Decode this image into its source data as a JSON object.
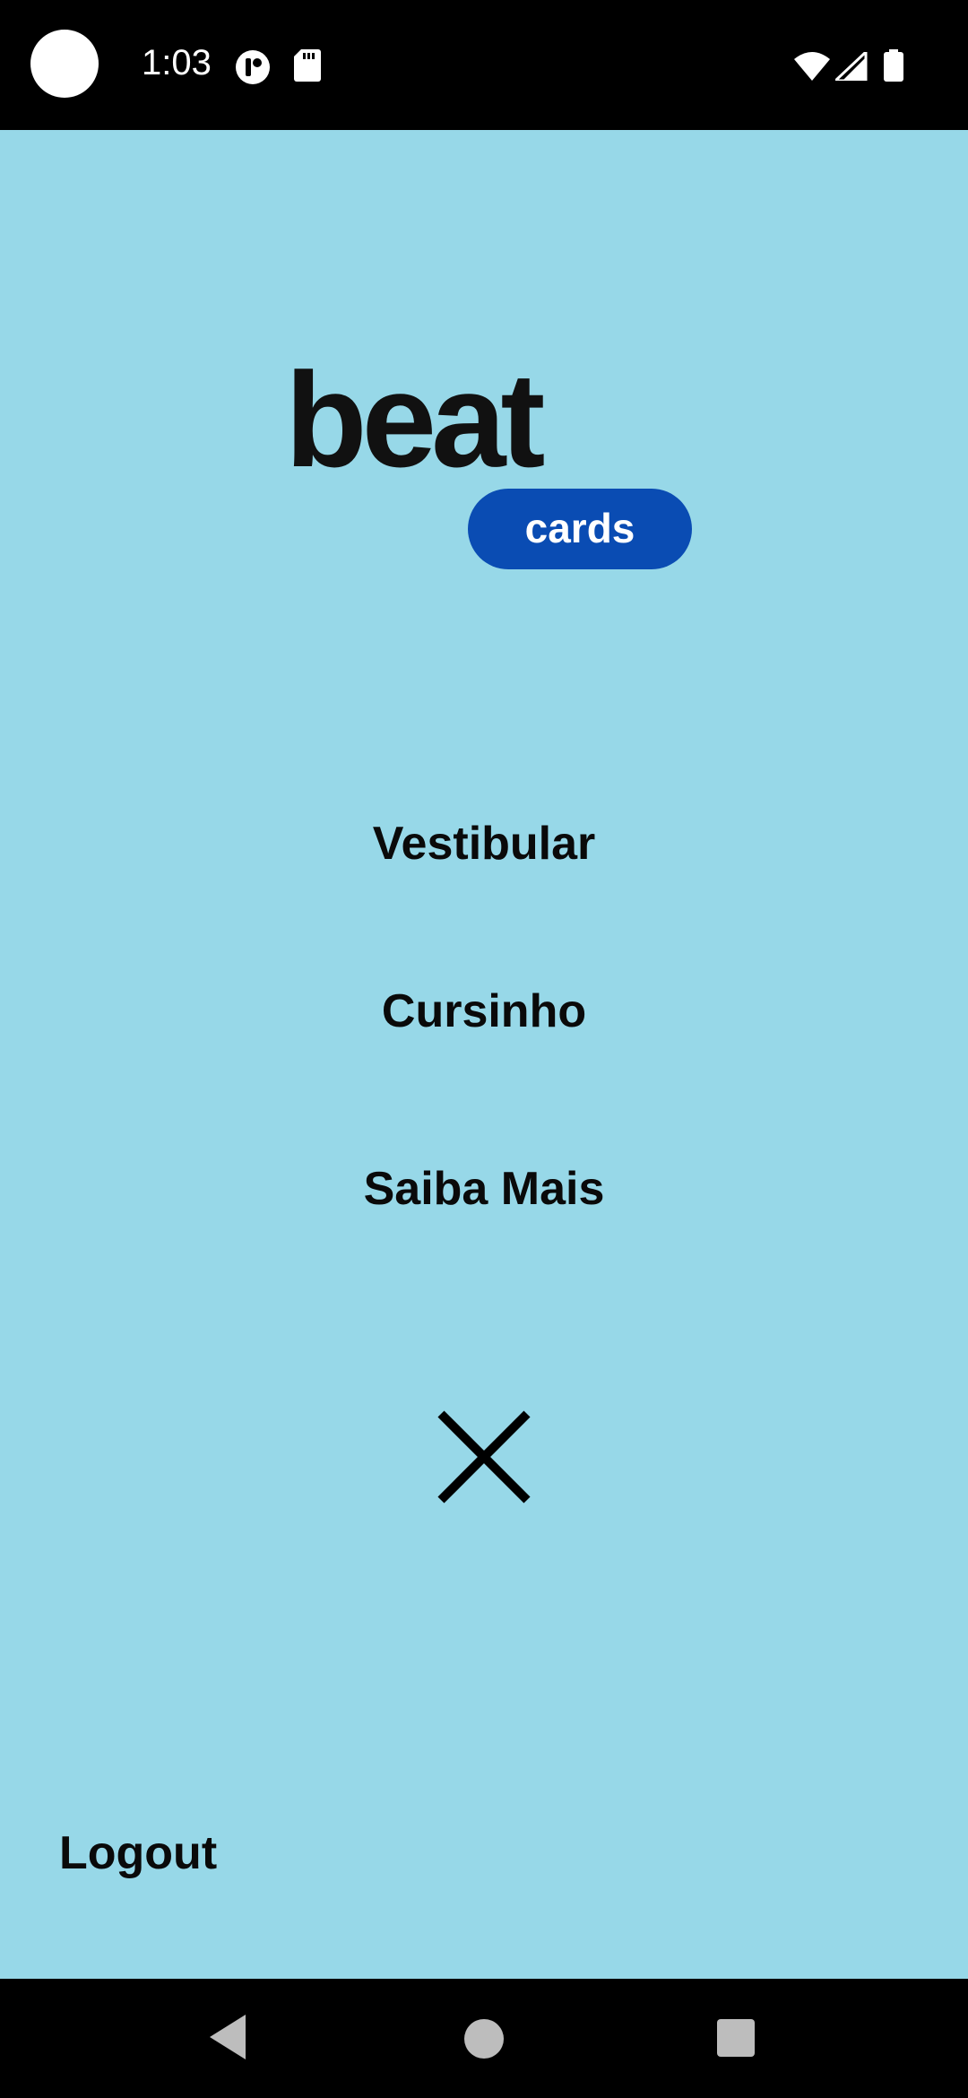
{
  "status_bar": {
    "time": "1:03",
    "icons": [
      "camera-dot",
      "p-app-icon",
      "sd-card-icon",
      "wifi-icon",
      "cell-signal-icon",
      "battery-icon"
    ]
  },
  "logo": {
    "word": "beat",
    "badge": "cards",
    "colors": {
      "word": "#111111",
      "badge_bg": "#0a4cb3",
      "badge_text": "#ffffff"
    }
  },
  "menu": {
    "items": [
      {
        "label": "Vestibular"
      },
      {
        "label": "Cursinho"
      },
      {
        "label": "Saiba Mais"
      }
    ],
    "close_icon": "close-icon"
  },
  "footer": {
    "logout_label": "Logout"
  },
  "nav_bar": {
    "buttons": [
      "back-icon",
      "home-icon",
      "recents-icon"
    ]
  },
  "theme": {
    "background": "#97d8e8",
    "text": "#0a0a0a",
    "system_bars": "#000000"
  }
}
